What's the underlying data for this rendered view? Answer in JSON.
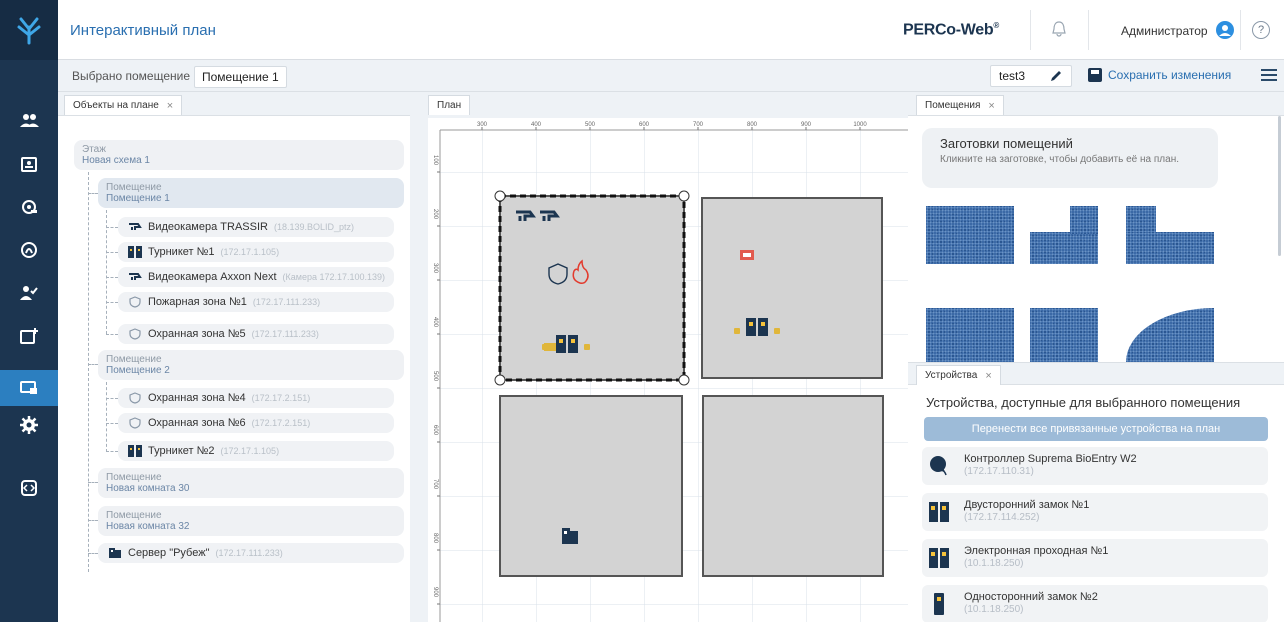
{
  "header": {
    "title": "Интерактивный план",
    "brand": "PERCo-Web",
    "user": "Администратор",
    "help": "?"
  },
  "toolbar": {
    "crumb_selected": "Выбрано помещение",
    "crumb_room": "Помещение 1",
    "plan_name": "test3",
    "save_label": "Сохранить изменения"
  },
  "left_panel": {
    "tab": "Объекты на плане",
    "floor": {
      "type": "Этаж",
      "name": "Новая схема 1"
    },
    "room1": {
      "type": "Помещение",
      "name": "Помещение 1",
      "items": [
        {
          "name": "Видеокамера TRASSIR",
          "ip": "(18.139.BOLID_ptz)"
        },
        {
          "name": "Турникет №1",
          "ip": "(172.17.1.105)"
        },
        {
          "name": "Видеокамера Axxon Next",
          "ip": "(Камера 172.17.100.139)"
        },
        {
          "name": "Пожарная зона №1",
          "ip": "(172.17.111.233)"
        },
        {
          "name": "Охранная зона №5",
          "ip": "(172.17.111.233)"
        }
      ]
    },
    "room2": {
      "type": "Помещение",
      "name": "Помещение 2",
      "items": [
        {
          "name": "Охранная зона №4",
          "ip": "(172.17.2.151)"
        },
        {
          "name": "Охранная зона №6",
          "ip": "(172.17.2.151)"
        },
        {
          "name": "Турникет №2",
          "ip": "(172.17.1.105)"
        }
      ]
    },
    "room3": {
      "type": "Помещение",
      "name": "Новая комната 30"
    },
    "room4": {
      "type": "Помещение",
      "name": "Новая комната 32"
    },
    "server": {
      "name": "Сервер \"Рубеж\"",
      "ip": "(172.17.111.233)"
    }
  },
  "plan": {
    "tab": "План",
    "ruler_top": [
      "300",
      "400",
      "500",
      "600",
      "700",
      "800",
      "900",
      "1000"
    ],
    "ruler_left": [
      "100",
      "200",
      "300",
      "400",
      "500",
      "600",
      "700",
      "800",
      "900"
    ]
  },
  "rooms_panel": {
    "tab": "Помещения",
    "blanks_title": "Заготовки помещений",
    "blanks_hint": "Кликните на заготовке, чтобы добавить её на план."
  },
  "devices_panel": {
    "tab": "Устройства",
    "title": "Устройства, доступные для выбранного помещения",
    "move_all": "Перенести все привязанные устройства на план",
    "items": [
      {
        "name": "Контроллер Suprema BioEntry W2",
        "ip": "(172.17.110.31)"
      },
      {
        "name": "Двусторонний замок №1",
        "ip": "(172.17.114.252)"
      },
      {
        "name": "Электронная проходная №1",
        "ip": "(10.1.18.250)"
      },
      {
        "name": "Односторонний замок №2",
        "ip": "(10.1.18.250)"
      }
    ]
  },
  "colors": {
    "sidebar": "#1c3550",
    "accent": "#2a6fb0",
    "active": "#2c7fc0"
  }
}
